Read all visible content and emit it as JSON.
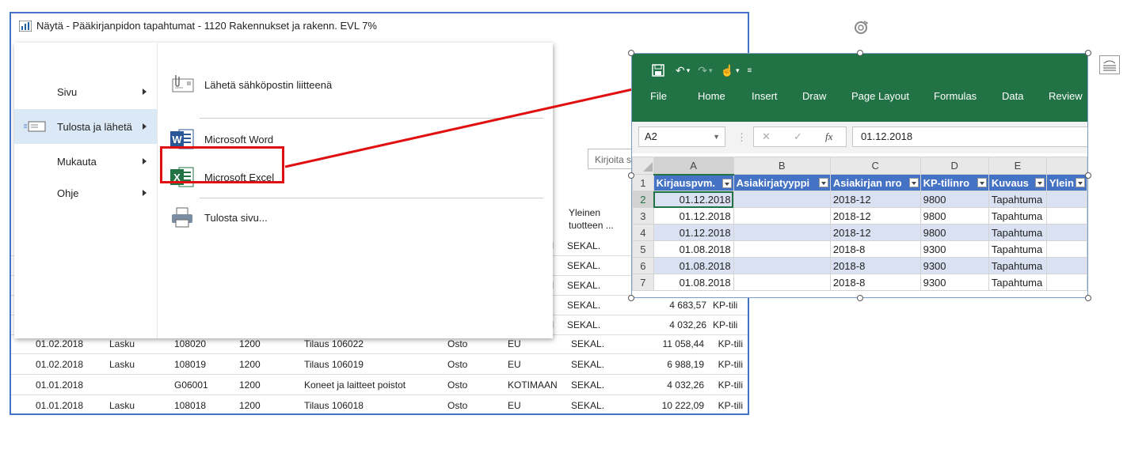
{
  "nav": {
    "title": "Näytä - Pääkirjanpidon tapahtumat - 1120 Rakennukset ja rakenn. EVL 7%",
    "search_placeholder": "Kirjoita s",
    "column_header_line1": "Yleinen",
    "column_header_line2": "tuotteen ...",
    "partial_rows": [
      {
        "mark": "I",
        "posting_group": "SEKAL.",
        "amount": "",
        "account_type": ""
      },
      {
        "mark": "",
        "posting_group": "SEKAL.",
        "amount": "",
        "account_type": ""
      },
      {
        "mark": "I",
        "posting_group": "SEKAL.",
        "amount": "",
        "account_type": ""
      },
      {
        "mark": "",
        "posting_group": "SEKAL.",
        "amount": "4 683,57",
        "account_type": "KP-tili"
      },
      {
        "mark": "I",
        "posting_group": "SEKAL.",
        "amount": "4 032,26",
        "account_type": "KP-tili"
      }
    ],
    "rows": [
      [
        "01.02.2018",
        "Lasku",
        "108020",
        "1200",
        "Tilaus 106022",
        "Osto",
        "EU",
        "SEKAL.",
        "11 058,44",
        "KP-tili"
      ],
      [
        "01.02.2018",
        "Lasku",
        "108019",
        "1200",
        "Tilaus 106019",
        "Osto",
        "EU",
        "SEKAL.",
        "6 988,19",
        "KP-tili"
      ],
      [
        "01.01.2018",
        "",
        "G06001",
        "1200",
        "Koneet ja laitteet poistot",
        "Osto",
        "KOTIMAAN",
        "SEKAL.",
        "4 032,26",
        "KP-tili"
      ],
      [
        "01.01.2018",
        "Lasku",
        "108018",
        "1200",
        "Tilaus 106018",
        "Osto",
        "EU",
        "SEKAL.",
        "10 222,09",
        "KP-tili"
      ]
    ]
  },
  "menu": {
    "items": [
      {
        "label": "Sivu"
      },
      {
        "label": "Tulosta ja lähetä"
      },
      {
        "label": "Mukauta"
      },
      {
        "label": "Ohje"
      }
    ],
    "sub": [
      {
        "label": "Lähetä sähköpostin liitteenä",
        "icon": "email-attachment-icon"
      },
      {
        "label": "Microsoft Word",
        "icon": "word-icon"
      },
      {
        "label": "Microsoft Excel",
        "icon": "excel-icon"
      },
      {
        "label": "Tulosta sivu...",
        "icon": "printer-icon"
      }
    ]
  },
  "excel": {
    "tabs": [
      "File",
      "Home",
      "Insert",
      "Draw",
      "Page Layout",
      "Formulas",
      "Data",
      "Review"
    ],
    "name_box": "A2",
    "formula": "01.12.2018",
    "fx": "fx",
    "col_letters": [
      "A",
      "B",
      "C",
      "D",
      "E"
    ],
    "headers": [
      "Kirjauspvm.",
      "Asiakirjatyyppi",
      "Asiakirjan nro",
      "KP-tilinro",
      "Kuvaus",
      "Ylein"
    ],
    "rows": [
      [
        "01.12.2018",
        "",
        "2018-12",
        "9800",
        "Tapahtuma"
      ],
      [
        "01.12.2018",
        "",
        "2018-12",
        "9800",
        "Tapahtuma"
      ],
      [
        "01.12.2018",
        "",
        "2018-12",
        "9800",
        "Tapahtuma"
      ],
      [
        "01.08.2018",
        "",
        "2018-8",
        "9300",
        "Tapahtuma"
      ],
      [
        "01.08.2018",
        "",
        "2018-8",
        "9300",
        "Tapahtuma"
      ],
      [
        "01.08.2018",
        "",
        "2018-8",
        "9300",
        "Tapahtuma"
      ]
    ],
    "row_numbers": [
      "1",
      "2",
      "3",
      "4",
      "5",
      "6",
      "7"
    ]
  },
  "colors": {
    "excel_green": "#217346",
    "header_blue": "#4472c4",
    "band": "#d9e1f2",
    "highlight_red": "#e01010",
    "nav_blue": "#1e5fa8"
  }
}
